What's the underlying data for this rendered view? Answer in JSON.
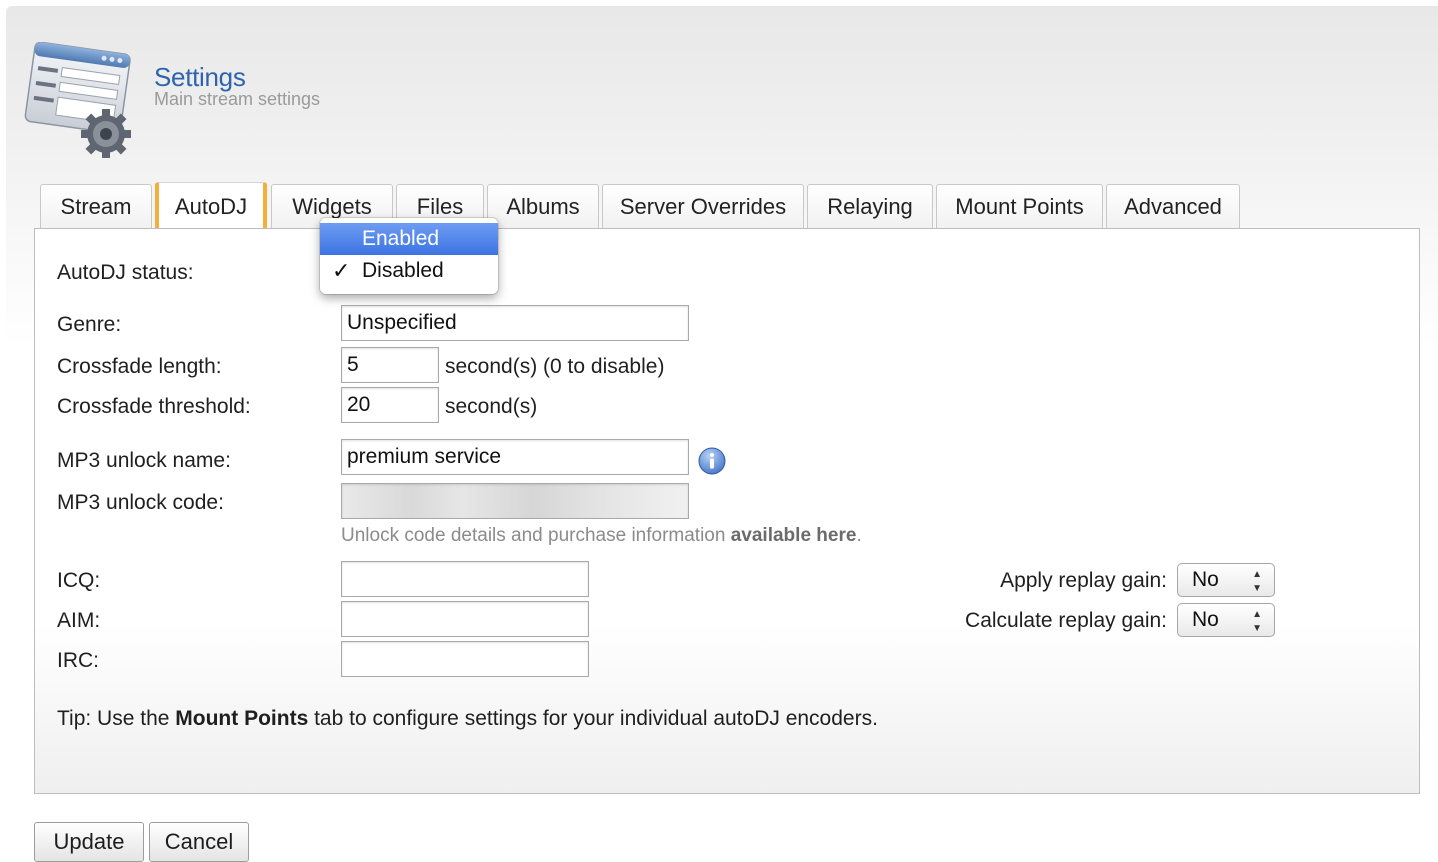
{
  "header": {
    "title": "Settings",
    "subtitle": "Main stream settings",
    "icon": "settings-form-gear-icon"
  },
  "tabs": [
    {
      "label": "Stream",
      "active": false
    },
    {
      "label": "AutoDJ",
      "active": true
    },
    {
      "label": "Widgets",
      "active": false
    },
    {
      "label": "Files",
      "active": false
    },
    {
      "label": "Albums",
      "active": false
    },
    {
      "label": "Server Overrides",
      "active": false
    },
    {
      "label": "Relaying",
      "active": false
    },
    {
      "label": "Mount Points",
      "active": false
    },
    {
      "label": "Advanced",
      "active": false
    }
  ],
  "form": {
    "autodj_status": {
      "label": "AutoDJ status:",
      "options": [
        "Enabled",
        "Disabled"
      ],
      "highlighted": "Enabled",
      "selected": "Disabled",
      "check_mark": "✓"
    },
    "genre": {
      "label": "Genre:",
      "value": "Unspecified"
    },
    "crossfade_length": {
      "label": "Crossfade length:",
      "value": "5",
      "suffix": "second(s) (0 to disable)"
    },
    "crossfade_threshold": {
      "label": "Crossfade threshold:",
      "value": "20",
      "suffix": "second(s)"
    },
    "mp3_unlock_name": {
      "label": "MP3 unlock name:",
      "value": "premium service",
      "info_icon": "info-icon"
    },
    "mp3_unlock_code": {
      "label": "MP3 unlock code:",
      "value": ""
    },
    "unlock_hint": {
      "text": "Unlock code details and purchase information ",
      "link": "available here",
      "end": "."
    },
    "icq": {
      "label": "ICQ:",
      "value": ""
    },
    "aim": {
      "label": "AIM:",
      "value": ""
    },
    "irc": {
      "label": "IRC:",
      "value": ""
    },
    "apply_replay_gain": {
      "label": "Apply replay gain:",
      "value": "No"
    },
    "calculate_replay_gain": {
      "label": "Calculate replay gain:",
      "value": "No"
    },
    "tip": {
      "prefix": "Tip: Use the ",
      "bold": "Mount Points",
      "suffix": " tab to configure settings for your individual autoDJ encoders."
    }
  },
  "actions": {
    "update": "Update",
    "cancel": "Cancel"
  },
  "colors": {
    "accent_tab": "#f0b13a",
    "title": "#2f63ad",
    "highlight": "#3d74e3"
  }
}
